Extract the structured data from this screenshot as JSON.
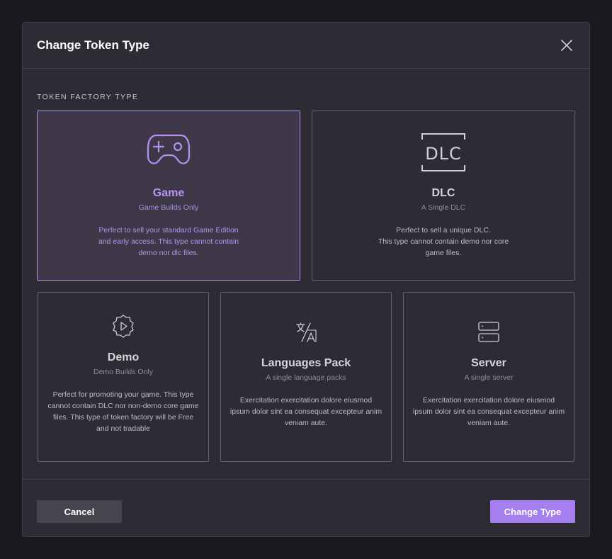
{
  "dialog": {
    "title": "Change Token Type",
    "section_label": "TOKEN FACTORY TYPE"
  },
  "cards": {
    "game": {
      "title": "Game",
      "subtitle": "Game Builds Only",
      "desc_lines": [
        "Perfect to sell your standard Game Edition",
        "and early access. This type cannot contain",
        "demo nor dlc files."
      ],
      "selected": true
    },
    "dlc": {
      "title": "DLC",
      "subtitle": "A Single DLC",
      "desc_lines": [
        "Perfect to sell a unique DLC.",
        "This type cannot contain demo nor core",
        "game files."
      ],
      "icon_text": "DLC"
    },
    "demo": {
      "title": "Demo",
      "subtitle": "Demo Builds Only",
      "desc_lines": [
        "Perfect for promoting your game. This type",
        "cannot contain DLC nor non-demo core game",
        "files. This type of token factory will be Free",
        "and not tradable"
      ]
    },
    "languages": {
      "title": "Languages Pack",
      "subtitle": "A single language packs",
      "desc_lines": [
        "Exercitation exercitation dolore eiusmod",
        "ipsum dolor sint ea consequat excepteur anim",
        "veniam aute."
      ]
    },
    "server": {
      "title": "Server",
      "subtitle": "A single server",
      "desc_lines": [
        "Exercitation exercitation dolore eiusmod",
        "ipsum dolor sint ea consequat excepteur anim",
        "veniam aute."
      ]
    }
  },
  "footer": {
    "cancel_label": "Cancel",
    "change_label": "Change Type"
  },
  "colors": {
    "accent": "#a57ef0",
    "background": "#2d2b33"
  }
}
